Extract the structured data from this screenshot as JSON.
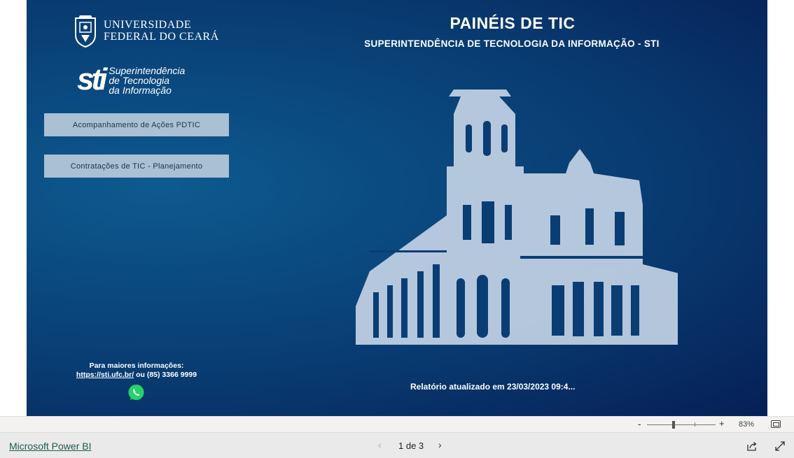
{
  "header": {
    "title": "PAINÉIS DE TIC",
    "subtitle": "SUPERINTENDÊNCIA DE TECNOLOGIA DA INFORMAÇÃO - STI"
  },
  "logos": {
    "ufc_line1": "UNIVERSIDADE",
    "ufc_line2": "FEDERAL DO CEARÁ",
    "sti_mark": "sti",
    "sti_line1": "Superintendência",
    "sti_line2": "de Tecnologia",
    "sti_line3": "da Informação"
  },
  "nav": {
    "items": [
      {
        "label": "Acompanhamento de Ações PDTIC"
      },
      {
        "label": "Contratações de TIC - Planejamento"
      }
    ]
  },
  "contact": {
    "heading": "Para maiores informações:",
    "link": "https://sti.ufc.br/",
    "connector": " ou ",
    "phone": "(85) 3366 9999"
  },
  "report": {
    "updated": "Relatório atualizado em 23/03/2023 09:4..."
  },
  "zoom": {
    "minus": "-",
    "plus": "+",
    "level": "83%"
  },
  "footer": {
    "brand_link": "Microsoft Power BI",
    "page_indicator": "1 de 3",
    "prev": "‹",
    "next": "›"
  },
  "colors": {
    "canvas_bg": "#083a70",
    "button_bg": "#a9c0d5",
    "whatsapp": "#25d366"
  }
}
